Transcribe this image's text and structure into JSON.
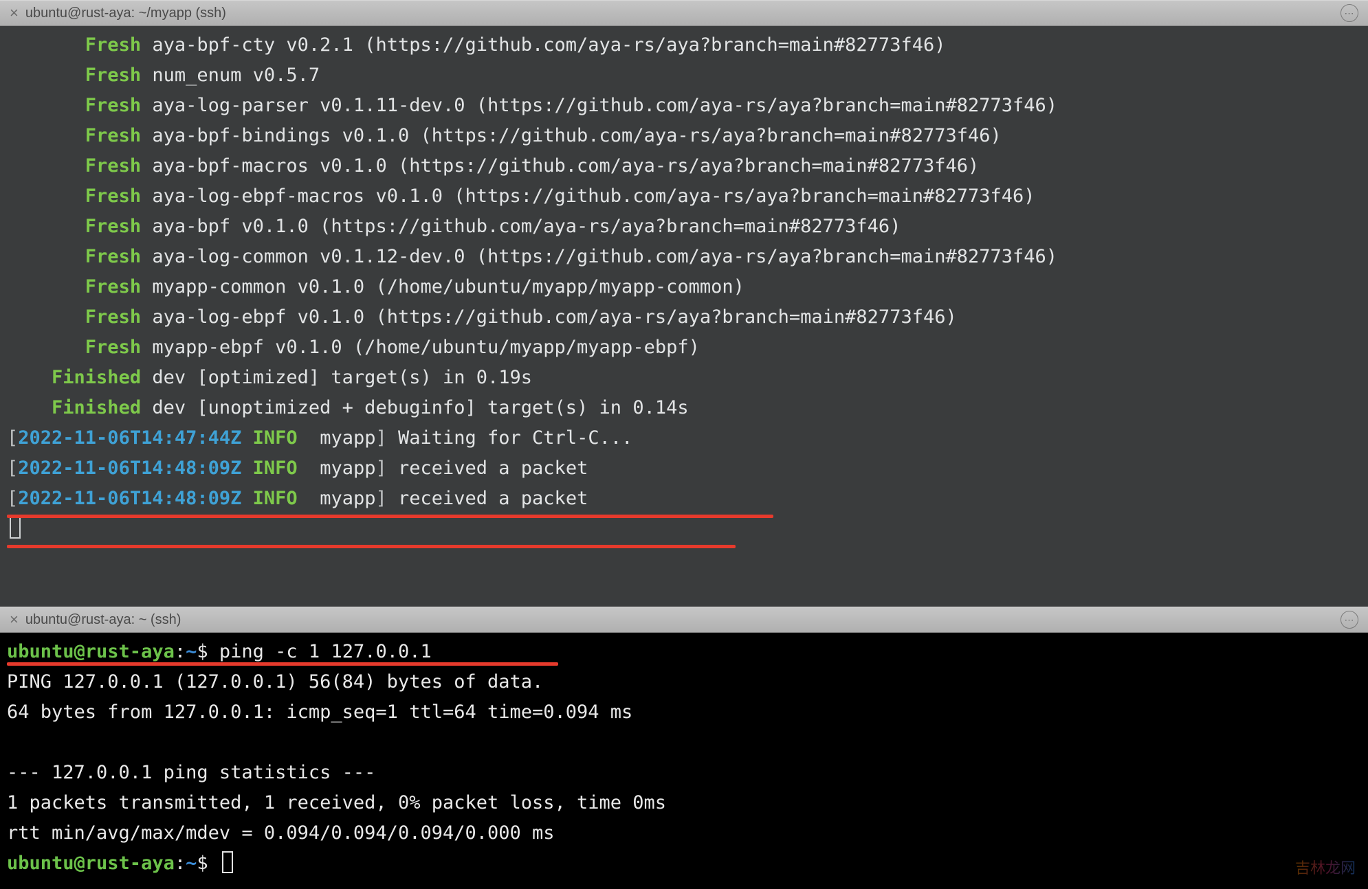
{
  "colors": {
    "top_bg": "#3a3c3d",
    "bottom_bg": "#000000",
    "green": "#7ec94b",
    "cyan": "#3fa2d6",
    "red_annotation": "#e63a2c"
  },
  "pane_top": {
    "title": "ubuntu@rust-aya: ~/myapp (ssh)",
    "lines": [
      {
        "kw": "Fresh",
        "rest": " aya-bpf-cty v0.2.1 (https://github.com/aya-rs/aya?branch=main#82773f46)"
      },
      {
        "kw": "Fresh",
        "rest": " num_enum v0.5.7"
      },
      {
        "kw": "Fresh",
        "rest": " aya-log-parser v0.1.11-dev.0 (https://github.com/aya-rs/aya?branch=main#82773f46)"
      },
      {
        "kw": "Fresh",
        "rest": " aya-bpf-bindings v0.1.0 (https://github.com/aya-rs/aya?branch=main#82773f46)"
      },
      {
        "kw": "Fresh",
        "rest": " aya-bpf-macros v0.1.0 (https://github.com/aya-rs/aya?branch=main#82773f46)"
      },
      {
        "kw": "Fresh",
        "rest": " aya-log-ebpf-macros v0.1.0 (https://github.com/aya-rs/aya?branch=main#82773f46)"
      },
      {
        "kw": "Fresh",
        "rest": " aya-bpf v0.1.0 (https://github.com/aya-rs/aya?branch=main#82773f46)"
      },
      {
        "kw": "Fresh",
        "rest": " aya-log-common v0.1.12-dev.0 (https://github.com/aya-rs/aya?branch=main#82773f46)"
      },
      {
        "kw": "Fresh",
        "rest": " myapp-common v0.1.0 (/home/ubuntu/myapp/myapp-common)"
      },
      {
        "kw": "Fresh",
        "rest": " aya-log-ebpf v0.1.0 (https://github.com/aya-rs/aya?branch=main#82773f46)"
      },
      {
        "kw": "Fresh",
        "rest": " myapp-ebpf v0.1.0 (/home/ubuntu/myapp/myapp-ebpf)"
      },
      {
        "kw": "Finished",
        "rest": " dev [optimized] target(s) in 0.19s"
      },
      {
        "kw": "Finished",
        "rest": " dev [unoptimized + debuginfo] target(s) in 0.14s"
      }
    ],
    "log_lines": [
      {
        "ts": "2022-11-06T14:47:44Z",
        "level": "INFO",
        "module": "myapp",
        "msg": "Waiting for Ctrl-C..."
      },
      {
        "ts": "2022-11-06T14:48:09Z",
        "level": "INFO",
        "module": "myapp",
        "msg": "received a packet"
      },
      {
        "ts": "2022-11-06T14:48:09Z",
        "level": "INFO",
        "module": "myapp",
        "msg": "received a packet"
      }
    ]
  },
  "pane_bottom": {
    "title": "ubuntu@rust-aya: ~ (ssh)",
    "prompt_user": "ubuntu@rust-aya",
    "prompt_sep": ":",
    "prompt_cwd": "~",
    "prompt_symbol": "$",
    "command": "ping -c 1 127.0.0.1",
    "output": [
      "PING 127.0.0.1 (127.0.0.1) 56(84) bytes of data.",
      "64 bytes from 127.0.0.1: icmp_seq=1 ttl=64 time=0.094 ms",
      "",
      "--- 127.0.0.1 ping statistics ---",
      "1 packets transmitted, 1 received, 0% packet loss, time 0ms",
      "rtt min/avg/max/mdev = 0.094/0.094/0.094/0.000 ms"
    ]
  },
  "watermark": "吉林龙网"
}
